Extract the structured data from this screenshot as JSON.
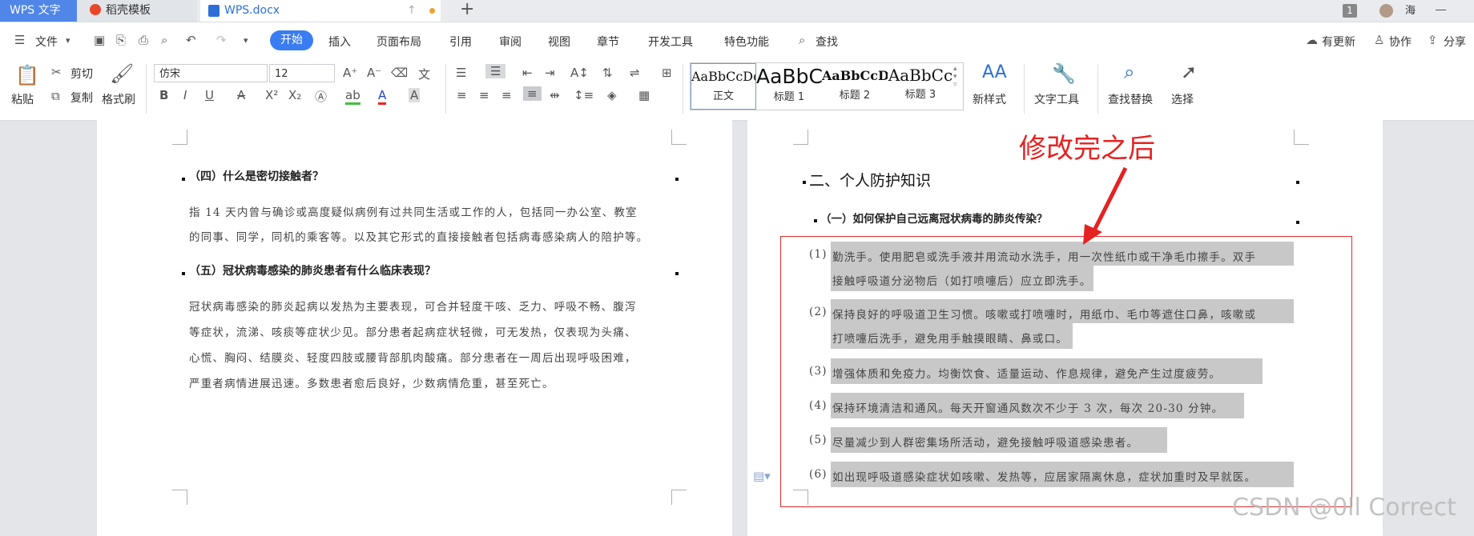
{
  "tabs": {
    "app": "WPS 文字",
    "template": "稻壳模板",
    "document": "WPS.docx",
    "add": "+",
    "window_count": "1",
    "user": "海"
  },
  "menu": {
    "file": "文件",
    "items": [
      "开始",
      "插入",
      "页面布局",
      "引用",
      "审阅",
      "视图",
      "章节",
      "开发工具",
      "特色功能"
    ],
    "search": "查找",
    "update": "有更新",
    "collab": "协作",
    "share": "分享"
  },
  "ribbon": {
    "paste": "粘贴",
    "cut": "剪切",
    "copy": "复制",
    "format_painter": "格式刷",
    "font_name": "仿宋",
    "font_size": "12",
    "styles": [
      {
        "preview": "AaBbCcDd",
        "name": "正文"
      },
      {
        "preview": "AaBbC",
        "name": "标题 1"
      },
      {
        "preview": "AaBbCcDd",
        "name": "标题 2"
      },
      {
        "preview": "AaBbCc",
        "name": "标题 3"
      }
    ],
    "new_style": "新样式",
    "text_tools": "文字工具",
    "find_replace": "查找替换",
    "select": "选择"
  },
  "left_page": {
    "h4": "（四）什么是密切接触者？",
    "p4": [
      "指 14 天内曾与确诊或高度疑似病例有过共同生活或工作的人，包括同一办公室、教室",
      "的同事、同学，同机的乘客等。以及其它形式的直接接触者包括病毒感染病人的陪护等。"
    ],
    "h5": "（五）冠状病毒感染的肺炎患者有什么临床表现？",
    "p5": [
      "冠状病毒感染的肺炎起病以发热为主要表现，可合并轻度干咳、乏力、呼吸不畅、腹泻",
      "等症状，流涕、咳痰等症状少见。部分患者起病症状轻微，可无发热，仅表现为头痛、",
      "心慌、胸闷、结膜炎、轻度四肢或腰背部肌肉酸痛。部分患者在一周后出现呼吸困难，",
      "严重者病情进展迅速。多数患者愈后良好，少数病情危重，甚至死亡。"
    ]
  },
  "right_page": {
    "section": "二、个人防护知识",
    "h1": "（一）如何保护自己远离冠状病毒的肺炎传染？",
    "items": [
      {
        "num": "(1)",
        "lines": [
          "勤洗手。使用肥皂或洗手液并用流动水洗手，用一次性纸巾或干净毛巾擦手。双手",
          "接触呼吸道分泌物后（如打喷嚏后）应立即洗手。"
        ]
      },
      {
        "num": "(2)",
        "lines": [
          "保持良好的呼吸道卫生习惯。咳嗽或打喷嚏时，用纸巾、毛巾等遮住口鼻，咳嗽或",
          "打喷嚏后洗手，避免用手触摸眼睛、鼻或口。"
        ]
      },
      {
        "num": "(3)",
        "lines": [
          "增强体质和免疫力。均衡饮食、适量运动、作息规律，避免产生过度疲劳。"
        ]
      },
      {
        "num": "(4)",
        "lines": [
          "保持环境清洁和通风。每天开窗通风数次不少于 3 次，每次 20-30 分钟。"
        ]
      },
      {
        "num": "(5)",
        "lines": [
          "尽量减少到人群密集场所活动，避免接触呼吸道感染患者。"
        ]
      },
      {
        "num": "(6)",
        "lines": [
          "如出现呼吸道感染症状如咳嗽、发热等，应居家隔离休息，症状加重时及早就医。"
        ]
      }
    ]
  },
  "annotation": "修改完之后",
  "watermark": "CSDN @0ll Correct",
  "colors": {
    "accent": "#3a7df2",
    "annotation": "#e52222",
    "highlight": "#c8c8c8"
  }
}
